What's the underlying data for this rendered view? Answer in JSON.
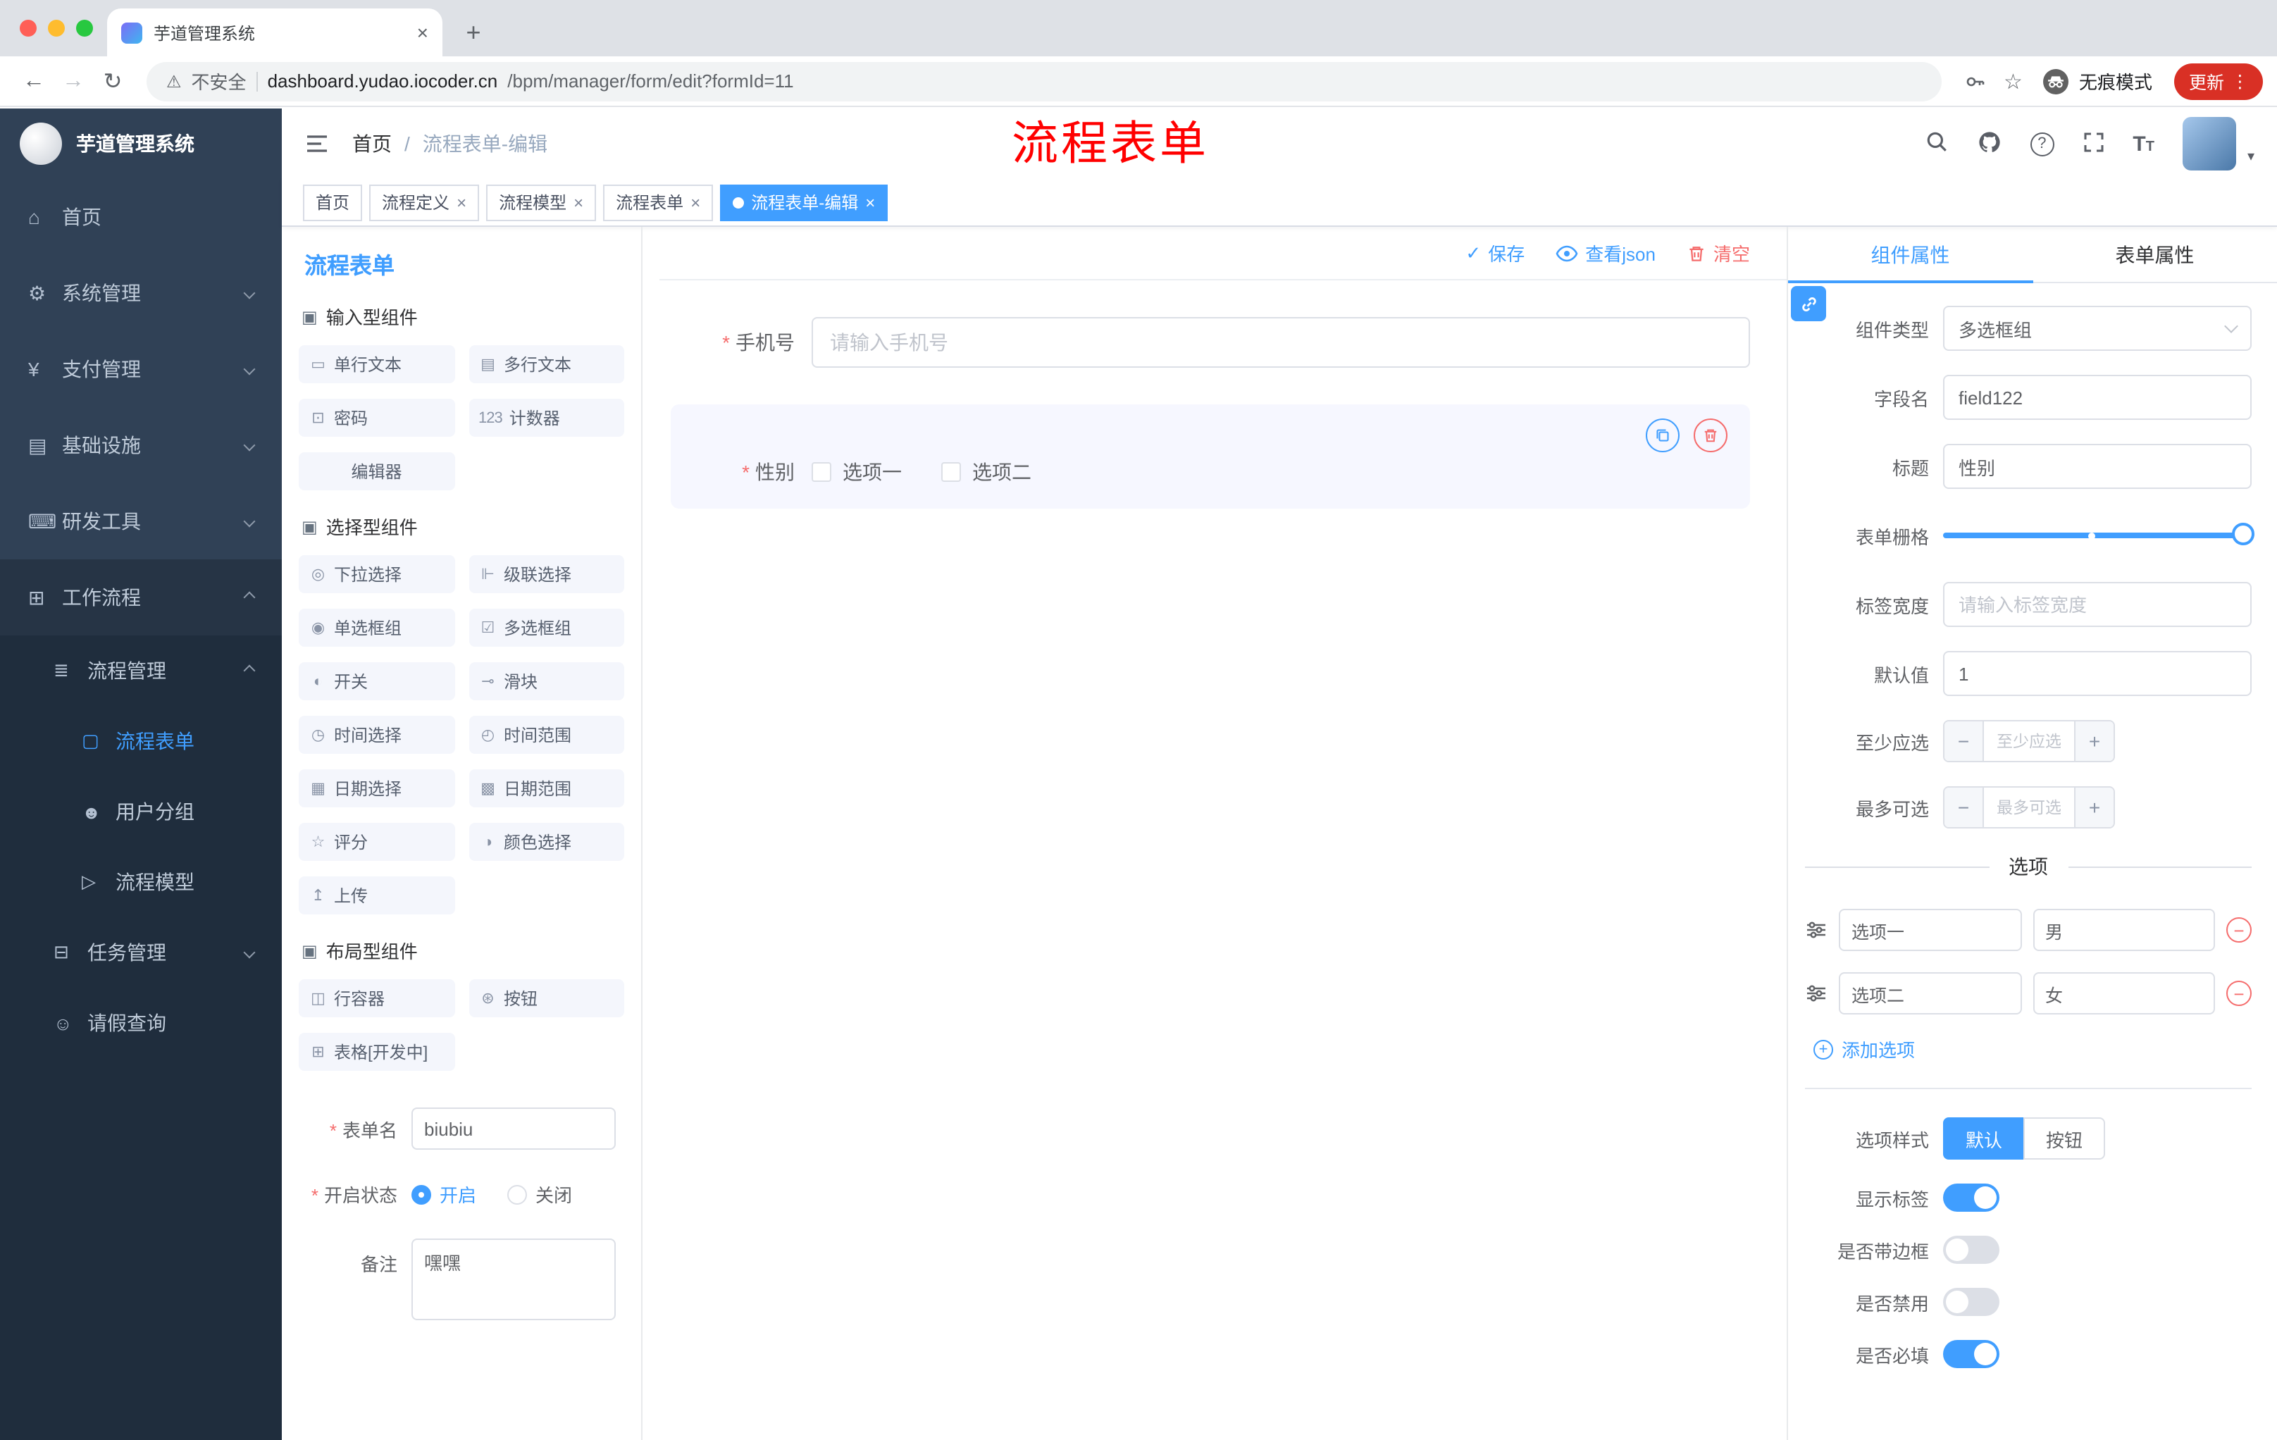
{
  "browser": {
    "tab_title": "芋道管理系统",
    "not_secure": "不安全",
    "url_domain": "dashboard.yudao.iocoder.cn",
    "url_path": "/bpm/manager/form/edit?formId=11",
    "incognito": "无痕模式",
    "update": "更新"
  },
  "annotation": {
    "text": "流程表单"
  },
  "colors": {
    "primary": "#409eff",
    "danger": "#f56c6c",
    "sidebar_bg": "#304156",
    "submenu_bg": "#1f2d3d"
  },
  "sidebar": {
    "logo": "芋道管理系统",
    "items": [
      {
        "label": "首页",
        "icon": "⌂"
      },
      {
        "label": "系统管理",
        "icon": "⚙"
      },
      {
        "label": "支付管理",
        "icon": "¥"
      },
      {
        "label": "基础设施",
        "icon": "▤"
      },
      {
        "label": "研发工具",
        "icon": "⌨"
      },
      {
        "label": "工作流程",
        "icon": "⊞"
      },
      {
        "label": "流程管理",
        "icon": "≣"
      },
      {
        "label": "流程表单",
        "icon": "▢"
      },
      {
        "label": "用户分组",
        "icon": "☻"
      },
      {
        "label": "流程模型",
        "icon": "▷"
      },
      {
        "label": "任务管理",
        "icon": "⊟"
      },
      {
        "label": "请假查询",
        "icon": "☺"
      }
    ]
  },
  "header": {
    "breadcrumb_home": "首页",
    "breadcrumb_sep": "/",
    "breadcrumb_current": "流程表单-编辑"
  },
  "tags": [
    {
      "label": "首页"
    },
    {
      "label": "流程定义"
    },
    {
      "label": "流程模型"
    },
    {
      "label": "流程表单"
    },
    {
      "label": "流程表单-编辑"
    }
  ],
  "palette": {
    "title": "流程表单",
    "sections": [
      {
        "title": "输入型组件",
        "items": [
          {
            "label": "单行文本",
            "icon": "▭"
          },
          {
            "label": "多行文本",
            "icon": "▤"
          },
          {
            "label": "密码",
            "icon": "⊡"
          },
          {
            "label": "计数器",
            "icon": "123"
          },
          {
            "label": "编辑器",
            "icon": ""
          }
        ]
      },
      {
        "title": "选择型组件",
        "items": [
          {
            "label": "下拉选择",
            "icon": "◎"
          },
          {
            "label": "级联选择",
            "icon": "⊩"
          },
          {
            "label": "单选框组",
            "icon": "◉"
          },
          {
            "label": "多选框组",
            "icon": "☑"
          },
          {
            "label": "开关",
            "icon": "◐"
          },
          {
            "label": "滑块",
            "icon": "⊸"
          },
          {
            "label": "时间选择",
            "icon": "◷"
          },
          {
            "label": "时间范围",
            "icon": "◴"
          },
          {
            "label": "日期选择",
            "icon": "▦"
          },
          {
            "label": "日期范围",
            "icon": "▩"
          },
          {
            "label": "评分",
            "icon": "☆"
          },
          {
            "label": "颜色选择",
            "icon": "◑"
          },
          {
            "label": "上传",
            "icon": "↥"
          }
        ]
      },
      {
        "title": "布局型组件",
        "items": [
          {
            "label": "行容器",
            "icon": "◫"
          },
          {
            "label": "按钮",
            "icon": "⊛"
          },
          {
            "label": "表格[开发中]",
            "icon": "⊞"
          }
        ]
      }
    ]
  },
  "form_meta": {
    "name_label": "表单名",
    "name_value": "biubiu",
    "status_label": "开启状态",
    "status_on": "开启",
    "status_off": "关闭",
    "remark_label": "备注",
    "remark_value": "嘿嘿"
  },
  "canvas": {
    "save": "保存",
    "view_json": "查看json",
    "clear": "清空",
    "phone_label": "手机号",
    "phone_placeholder": "请输入手机号",
    "gender_label": "性别",
    "gender_opt1": "选项一",
    "gender_opt2": "选项二"
  },
  "props": {
    "tab_component": "组件属性",
    "tab_form": "表单属性",
    "type_label": "组件类型",
    "type_value": "多选框组",
    "field_label": "字段名",
    "field_value": "field122",
    "title_label": "标题",
    "title_value": "性别",
    "grid_label": "表单栅格",
    "labelw_label": "标签宽度",
    "labelw_placeholder": "请输入标签宽度",
    "default_label": "默认值",
    "default_value": "1",
    "min_label": "至少应选",
    "min_placeholder": "至少应选",
    "max_label": "最多可选",
    "max_placeholder": "最多可选",
    "options_title": "选项",
    "opt1_label": "选项一",
    "opt1_value": "男",
    "opt2_label": "选项二",
    "opt2_value": "女",
    "add_option": "添加选项",
    "style_label": "选项样式",
    "style_default": "默认",
    "style_button": "按钮",
    "show_label": "显示标签",
    "border_label": "是否带边框",
    "disabled_label": "是否禁用",
    "required_label": "是否必填"
  }
}
